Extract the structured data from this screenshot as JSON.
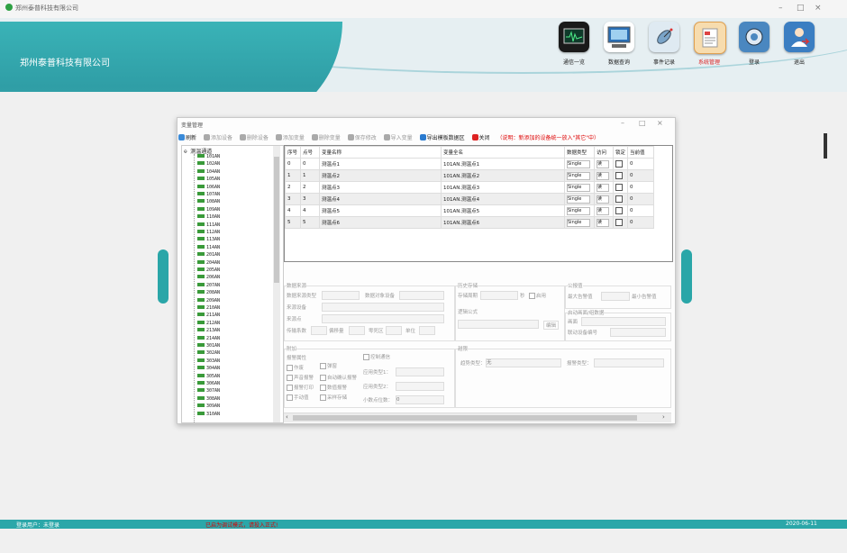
{
  "window": {
    "title": "郑州泰普科技有限公司"
  },
  "header": {
    "company": "郑州泰普科技有限公司"
  },
  "nav": [
    {
      "label": "通信一览",
      "icon": "monitor-wave-icon",
      "color": "#1a1a1a"
    },
    {
      "label": "数据查询",
      "icon": "computer-icon",
      "color": "#2a6fb5"
    },
    {
      "label": "事件记录",
      "icon": "satellite-icon",
      "color": "#7aa4c8"
    },
    {
      "label": "系统管理",
      "icon": "document-icon",
      "color": "#e8b870",
      "active": true
    },
    {
      "label": "登录",
      "icon": "gear-icon",
      "color": "#4a87c0"
    },
    {
      "label": "退出",
      "icon": "user-exit-icon",
      "color": "#3b7ec2"
    }
  ],
  "dialog": {
    "title": "变量管理",
    "toolbar": {
      "refresh": "刷新",
      "add_device": "添加设备",
      "delete_device": "删除设备",
      "add_variable": "添加变量",
      "delete_variable": "删除变量",
      "save_changes": "保存修改",
      "import_variables": "导入变量",
      "export_variables": "导出模板数据区",
      "close": "关闭",
      "note": "（说明：新添加的设备统一放入\"其它\"中）"
    },
    "tree": {
      "root": "测温通道",
      "items": [
        "101AN",
        "102AN",
        "104AN",
        "105AN",
        "106AN",
        "107AN",
        "108AN",
        "109AN",
        "110AN",
        "111AN",
        "112AN",
        "113AN",
        "114AN",
        "201AN",
        "204AN",
        "205AN",
        "206AN",
        "207AN",
        "208AN",
        "209AN",
        "210AN",
        "211AN",
        "212AN",
        "213AN",
        "214AN",
        "301AN",
        "302AN",
        "303AN",
        "304AN",
        "305AN",
        "306AN",
        "307AN",
        "308AN",
        "309AN",
        "310AN"
      ]
    },
    "grid": {
      "headers": [
        "序号",
        "点号",
        "变量名称",
        "变量全名",
        "数据类型",
        "访问",
        "锁定",
        "当前值"
      ],
      "rows": [
        {
          "index": "0",
          "point": "0",
          "name": "测温点1",
          "fullname": "101AN.测温点1",
          "type": "Single",
          "access": "读",
          "value": "0"
        },
        {
          "index": "1",
          "point": "1",
          "name": "测温点2",
          "fullname": "101AN.测温点2",
          "type": "Single",
          "access": "读",
          "value": "0"
        },
        {
          "index": "2",
          "point": "2",
          "name": "测温点3",
          "fullname": "101AN.测温点3",
          "type": "Single",
          "access": "读",
          "value": "0"
        },
        {
          "index": "3",
          "point": "3",
          "name": "测温点4",
          "fullname": "101AN.测温点4",
          "type": "Single",
          "access": "读",
          "value": "0"
        },
        {
          "index": "4",
          "point": "4",
          "name": "测温点5",
          "fullname": "101AN.测温点5",
          "type": "Single",
          "access": "读",
          "value": "0"
        },
        {
          "index": "5",
          "point": "5",
          "name": "测温点6",
          "fullname": "101AN.测温点6",
          "type": "Single",
          "access": "读",
          "value": "0"
        }
      ]
    },
    "form": {
      "data_source": "数据来源",
      "source_type": "数据来源类型",
      "source_device": "数据对象设备",
      "source_device_label": "来源设备",
      "source_point": "来源点",
      "base_coef": "传输系数",
      "offset": "偏移量",
      "dead_zone": "零死区",
      "unit": "单位",
      "history": "历史存储",
      "store_period": "存储周期",
      "seconds": "秒",
      "enable": "启用",
      "formula": "逻辑公式",
      "edit": "编辑",
      "alarm": "公报值",
      "max_alarm": "最大告警值",
      "min_alarm": "最小告警值",
      "realtime": "启动画面/组数据",
      "screen": "画面",
      "linked_device": "联动设备编号",
      "other": "附加",
      "alarm_attr": "报警属性",
      "opts": [
        "作废",
        "弹窗",
        "声音报警",
        "自动确认报警",
        "报警打印",
        "数值报警",
        "手动值",
        "采样存储"
      ],
      "ctrl_comm": "控制通信",
      "apply_type1": "应用类型1：",
      "apply_type2": "应用类型2：",
      "decimals": "小数点位数：",
      "decimals_value": "0",
      "alarm_sec": "越限",
      "trend_type": "趋势类型：",
      "trend_value": "无",
      "alert_type": "报警类型："
    }
  },
  "status": {
    "user": "登录用户：未登录",
    "warn": "已启为调试模式，请投入正式!",
    "date": "2020-06-11"
  }
}
